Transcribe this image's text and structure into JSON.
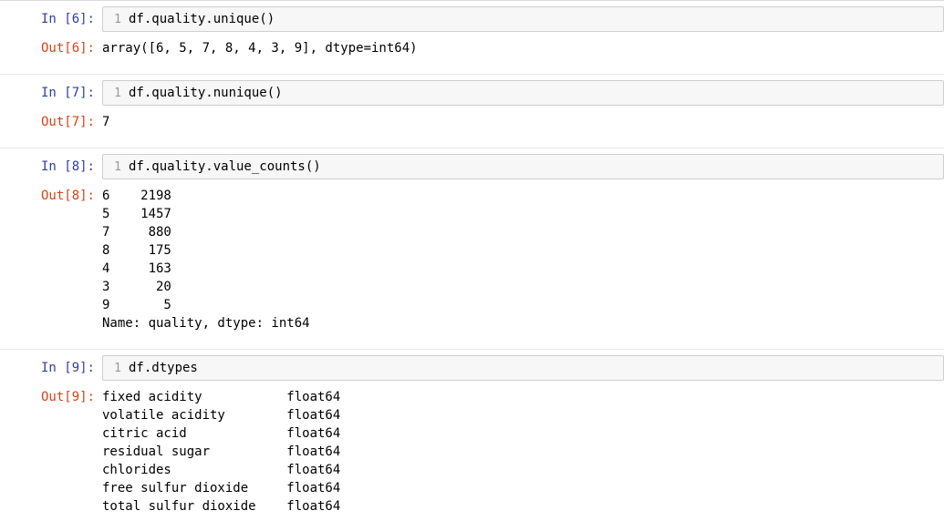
{
  "cells": [
    {
      "in_prompt": "In [6]:",
      "line_no": "1",
      "code": "df.quality.unique()",
      "out_prompt": "Out[6]:",
      "output": "array([6, 5, 7, 8, 4, 3, 9], dtype=int64)"
    },
    {
      "in_prompt": "In [7]:",
      "line_no": "1",
      "code": "df.quality.nunique()",
      "out_prompt": "Out[7]:",
      "output": "7"
    },
    {
      "in_prompt": "In [8]:",
      "line_no": "1",
      "code": "df.quality.value_counts()",
      "out_prompt": "Out[8]:",
      "output": "6    2198\n5    1457\n7     880\n8     175\n4     163\n3      20\n9       5\nName: quality, dtype: int64"
    },
    {
      "in_prompt": "In [9]:",
      "line_no": "1",
      "code": "df.dtypes",
      "out_prompt": "Out[9]:",
      "output": "fixed acidity           float64\nvolatile acidity        float64\ncitric acid             float64\nresidual sugar          float64\nchlorides               float64\nfree sulfur dioxide     float64\ntotal sulfur dioxide    float64"
    }
  ]
}
